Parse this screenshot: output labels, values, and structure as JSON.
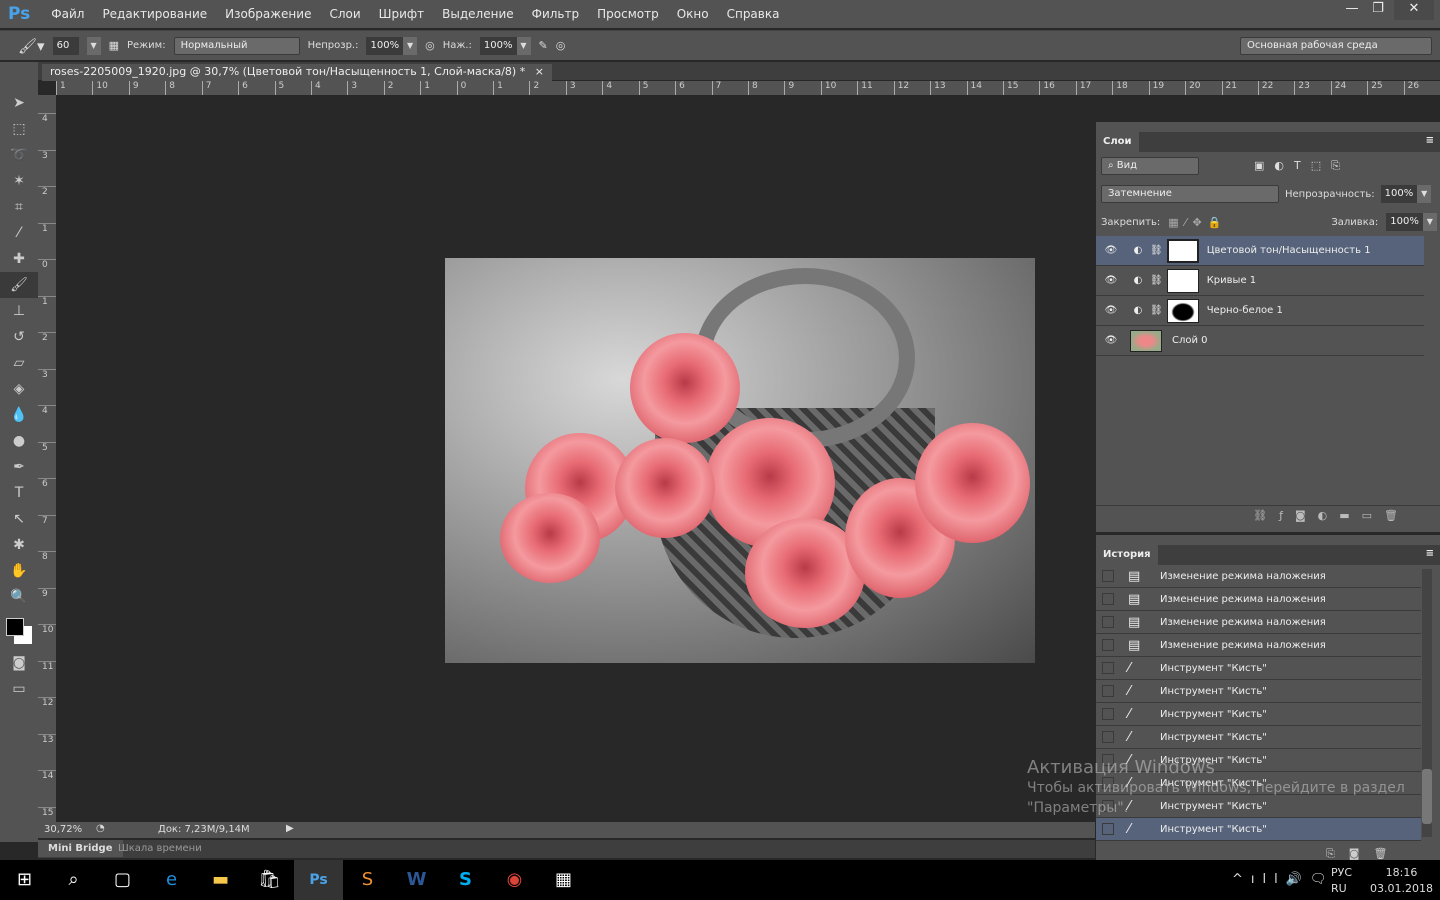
{
  "app": {
    "logo": "Ps"
  },
  "menu": [
    "Файл",
    "Редактирование",
    "Изображение",
    "Слои",
    "Шрифт",
    "Выделение",
    "Фильтр",
    "Просмотр",
    "Окно",
    "Справка"
  ],
  "window_controls": {
    "minimize": "—",
    "restore": "❐",
    "close": "✕"
  },
  "options": {
    "brush_size": "60",
    "mode_label": "Режим:",
    "mode_value": "Нормальный",
    "opacity_label": "Непрозр.:",
    "opacity_value": "100%",
    "flow_label": "Наж.:",
    "flow_value": "100%",
    "workspace": "Основная рабочая среда"
  },
  "document": {
    "tab_title": "roses-2205009_1920.jpg @ 30,7% (Цветовой тон/Насыщенность 1, Слой-маска/8) *",
    "close": "×"
  },
  "rulers": {
    "top": [
      "1",
      "10",
      "9",
      "8",
      "7",
      "6",
      "5",
      "4",
      "3",
      "2",
      "1",
      "0",
      "1",
      "2",
      "3",
      "4",
      "5",
      "6",
      "7",
      "8",
      "9",
      "10",
      "11",
      "12",
      "13",
      "14",
      "15",
      "16",
      "17",
      "18",
      "19",
      "20",
      "21",
      "22",
      "23",
      "24",
      "25",
      "26"
    ],
    "left": [
      "4",
      "3",
      "2",
      "1",
      "0",
      "1",
      "2",
      "3",
      "4",
      "5",
      "6",
      "7",
      "8",
      "9",
      "10",
      "11",
      "12",
      "13",
      "14",
      "15"
    ]
  },
  "status": {
    "zoom": "30,72%",
    "doc": "Док: 7,23M/9,14M"
  },
  "bottom_tabs": [
    "Mini Bridge",
    "Шкала времени"
  ],
  "layers_panel": {
    "title": "Слои",
    "filter": "Вид",
    "blend_mode": "Затемнение",
    "opacity_label": "Непрозрачность:",
    "opacity": "100%",
    "lock_label": "Закрепить:",
    "fill_label": "Заливка:",
    "fill": "100%",
    "layers": [
      {
        "name": "Цветовой тон/Насыщенность 1",
        "selected": true
      },
      {
        "name": "Кривые 1",
        "selected": false
      },
      {
        "name": "Черно-белое 1",
        "selected": false
      },
      {
        "name": "Слой 0",
        "selected": false
      }
    ]
  },
  "history_panel": {
    "title": "История",
    "items": [
      "Изменение режима наложения",
      "Изменение режима наложения",
      "Изменение режима наложения",
      "Изменение режима наложения",
      "Инструмент \"Кисть\"",
      "Инструмент \"Кисть\"",
      "Инструмент \"Кисть\"",
      "Инструмент \"Кисть\"",
      "Инструмент \"Кисть\"",
      "Инструмент \"Кисть\"",
      "Инструмент \"Кисть\"",
      "Инструмент \"Кисть\""
    ],
    "selected_index": 11
  },
  "watermark": {
    "line1": "Активация Windows",
    "line2": "Чтобы активировать Windows, перейдите в раздел",
    "line3": "\"Параметры\"."
  },
  "taskbar": {
    "lang1": "РУС",
    "lang2": "RU",
    "time": "18:16",
    "date": "03.01.2018"
  },
  "colors": {
    "accent": "#4aa3e8",
    "selection": "#56637a",
    "panel": "#535353",
    "workspace": "#282828"
  }
}
